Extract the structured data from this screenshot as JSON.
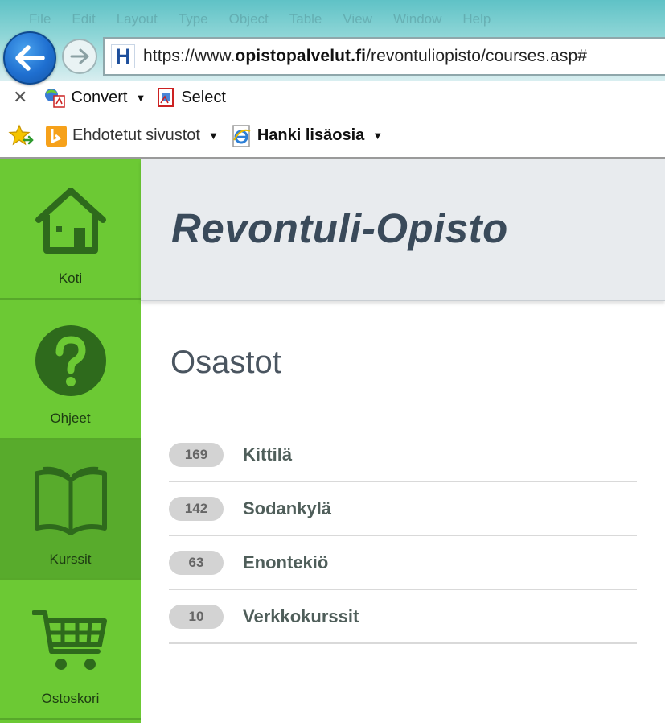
{
  "browser": {
    "menu_items": [
      "File",
      "Edit",
      "Layout",
      "Type",
      "Object",
      "Table",
      "View",
      "Window",
      "Help"
    ],
    "address": {
      "scheme": "https://www.",
      "domain": "opistopalvelut.fi",
      "path": "/revontuliopisto/courses.asp#"
    },
    "toolbar1": {
      "convert_label": "Convert",
      "select_label": "Select"
    },
    "toolbar2": {
      "suggested_sites_label": "Ehdotetut sivustot",
      "get_more_label": "Hanki lisäosia"
    }
  },
  "sidebar": {
    "items": [
      {
        "label": "Koti",
        "icon": "home-icon"
      },
      {
        "label": "Ohjeet",
        "icon": "question-icon"
      },
      {
        "label": "Kurssit",
        "icon": "book-icon"
      },
      {
        "label": "Ostoskori",
        "icon": "cart-icon"
      }
    ]
  },
  "header": {
    "title": "Revontuli-Opisto"
  },
  "main": {
    "section_title": "Osastot",
    "departments": [
      {
        "count": "169",
        "name": "Kittilä"
      },
      {
        "count": "142",
        "name": "Sodankylä"
      },
      {
        "count": "63",
        "name": "Enontekiö"
      },
      {
        "count": "10",
        "name": "Verkkokurssit"
      }
    ]
  },
  "colors": {
    "sidebar_green": "#6cc934",
    "sidebar_active": "#58ab2c",
    "icon_dark_green": "#2e6a1c",
    "header_bg": "#e8ebee",
    "title_text": "#3a4a5a"
  }
}
